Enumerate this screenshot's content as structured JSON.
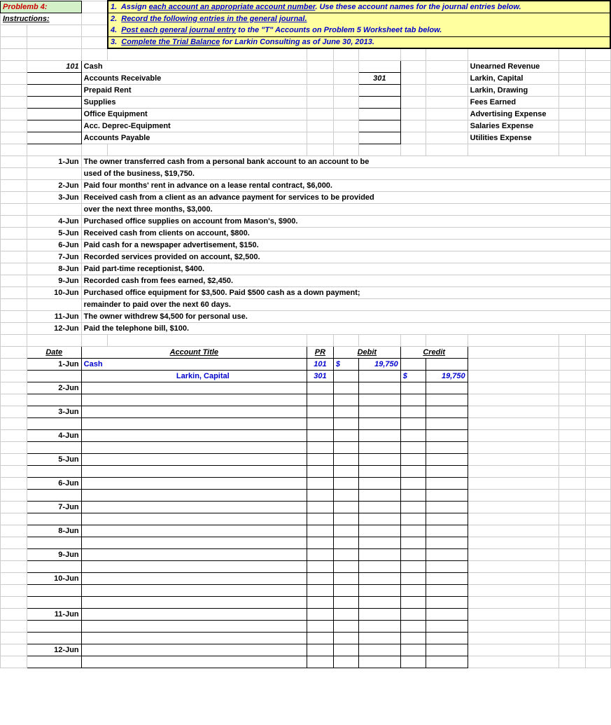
{
  "header": {
    "problem": "Problemb 4:",
    "instructions_label": "Instructions:",
    "lines": [
      {
        "num": "1.",
        "prefix": "Assign ",
        "link": "each account an appropriate account number",
        "suffix": ".  Use these account names for the journal entries below."
      },
      {
        "num": "2.",
        "prefix": "",
        "link": "Record the following entries in the general journal.",
        "suffix": ""
      },
      {
        "num": "4.",
        "prefix": "",
        "link": "Post each general journal entry",
        "suffix": " to the \"T\" Accounts on Problem 5 Worksheet tab below."
      },
      {
        "num": "3.",
        "prefix": "",
        "link": "Complete the Trial Balance",
        "suffix": " for Larkin Consulting as of June 30, 2013."
      }
    ]
  },
  "accounts_left": [
    {
      "num": "101",
      "name": "Cash"
    },
    {
      "num": "",
      "name": "Accounts Receivable"
    },
    {
      "num": "",
      "name": "Prepaid Rent"
    },
    {
      "num": "",
      "name": "Supplies"
    },
    {
      "num": "",
      "name": "Office Equipment"
    },
    {
      "num": "",
      "name": "Acc. Deprec-Equipment"
    },
    {
      "num": "",
      "name": "Accounts Payable"
    }
  ],
  "accounts_right": [
    {
      "num": "",
      "name": "Unearned Revenue"
    },
    {
      "num": "301",
      "name": "Larkin, Capital"
    },
    {
      "num": "",
      "name": "Larkin, Drawing"
    },
    {
      "num": "",
      "name": "Fees Earned"
    },
    {
      "num": "",
      "name": "Advertising Expense"
    },
    {
      "num": "",
      "name": "Salaries Expense"
    },
    {
      "num": "",
      "name": "Utilities Expense"
    }
  ],
  "transactions": [
    {
      "date": "1-Jun",
      "text": "The owner transferred cash from a personal bank account to an account to be"
    },
    {
      "date": "",
      "text": "used of the business, $19,750."
    },
    {
      "date": "2-Jun",
      "text": "Paid four months' rent in advance on a lease rental contract, $6,000."
    },
    {
      "date": "3-Jun",
      "text": "Received cash from a client as an advance payment for services to be provided"
    },
    {
      "date": "",
      "text": "over the next three months, $3,000."
    },
    {
      "date": "4-Jun",
      "text": "Purchased office supplies on account from Mason's, $900."
    },
    {
      "date": "5-Jun",
      "text": "Received cash from clients on account, $800."
    },
    {
      "date": "6-Jun",
      "text": "Paid cash for a newspaper advertisement, $150."
    },
    {
      "date": "7-Jun",
      "text": "Recorded services provided on account, $2,500."
    },
    {
      "date": "8-Jun",
      "text": "Paid part-time receptionist, $400."
    },
    {
      "date": "9-Jun",
      "text": "Recorded cash from fees earned, $2,450."
    },
    {
      "date": "10-Jun",
      "text": "Purchased office equipment for $3,500.  Paid $500 cash as a down payment;"
    },
    {
      "date": "",
      "text": "remainder to paid over the next 60 days."
    },
    {
      "date": "11-Jun",
      "text": "The owner withdrew $4,500 for personal use."
    },
    {
      "date": "12-Jun",
      "text": "Paid the telephone bill, $100."
    }
  ],
  "journal": {
    "headers": {
      "date": "Date",
      "title": "Account Title",
      "pr": "PR",
      "debit": "Debit",
      "credit": "Credit"
    },
    "rows": [
      {
        "date": "1-Jun",
        "title": "Cash",
        "indent": false,
        "pr": "101",
        "debit_s": "$",
        "debit_v": "19,750",
        "credit_s": "",
        "credit_v": "",
        "blue": true
      },
      {
        "date": "",
        "title": "Larkin, Capital",
        "indent": true,
        "pr": "301",
        "debit_s": "",
        "debit_v": "",
        "credit_s": "$",
        "credit_v": "19,750",
        "blue": true
      },
      {
        "date": "2-Jun",
        "title": "",
        "pr": "",
        "debit_s": "",
        "debit_v": "",
        "credit_s": "",
        "credit_v": ""
      },
      {
        "date": "",
        "title": "",
        "pr": "",
        "debit_s": "",
        "debit_v": "",
        "credit_s": "",
        "credit_v": ""
      },
      {
        "date": "3-Jun",
        "title": "",
        "pr": "",
        "debit_s": "",
        "debit_v": "",
        "credit_s": "",
        "credit_v": ""
      },
      {
        "date": "",
        "title": "",
        "pr": "",
        "debit_s": "",
        "debit_v": "",
        "credit_s": "",
        "credit_v": ""
      },
      {
        "date": "4-Jun",
        "title": "",
        "pr": "",
        "debit_s": "",
        "debit_v": "",
        "credit_s": "",
        "credit_v": ""
      },
      {
        "date": "",
        "title": "",
        "pr": "",
        "debit_s": "",
        "debit_v": "",
        "credit_s": "",
        "credit_v": ""
      },
      {
        "date": "5-Jun",
        "title": "",
        "pr": "",
        "debit_s": "",
        "debit_v": "",
        "credit_s": "",
        "credit_v": ""
      },
      {
        "date": "",
        "title": "",
        "pr": "",
        "debit_s": "",
        "debit_v": "",
        "credit_s": "",
        "credit_v": ""
      },
      {
        "date": "6-Jun",
        "title": "",
        "pr": "",
        "debit_s": "",
        "debit_v": "",
        "credit_s": "",
        "credit_v": ""
      },
      {
        "date": "",
        "title": "",
        "pr": "",
        "debit_s": "",
        "debit_v": "",
        "credit_s": "",
        "credit_v": ""
      },
      {
        "date": "7-Jun",
        "title": "",
        "pr": "",
        "debit_s": "",
        "debit_v": "",
        "credit_s": "",
        "credit_v": ""
      },
      {
        "date": "",
        "title": "",
        "pr": "",
        "debit_s": "",
        "debit_v": "",
        "credit_s": "",
        "credit_v": ""
      },
      {
        "date": "8-Jun",
        "title": "",
        "pr": "",
        "debit_s": "",
        "debit_v": "",
        "credit_s": "",
        "credit_v": ""
      },
      {
        "date": "",
        "title": "",
        "pr": "",
        "debit_s": "",
        "debit_v": "",
        "credit_s": "",
        "credit_v": ""
      },
      {
        "date": "9-Jun",
        "title": "",
        "pr": "",
        "debit_s": "",
        "debit_v": "",
        "credit_s": "",
        "credit_v": ""
      },
      {
        "date": "",
        "title": "",
        "pr": "",
        "debit_s": "",
        "debit_v": "",
        "credit_s": "",
        "credit_v": ""
      },
      {
        "date": "10-Jun",
        "title": "",
        "pr": "",
        "debit_s": "",
        "debit_v": "",
        "credit_s": "",
        "credit_v": ""
      },
      {
        "date": "",
        "title": "",
        "pr": "",
        "debit_s": "",
        "debit_v": "",
        "credit_s": "",
        "credit_v": ""
      },
      {
        "date": "",
        "title": "",
        "pr": "",
        "debit_s": "",
        "debit_v": "",
        "credit_s": "",
        "credit_v": ""
      },
      {
        "date": "11-Jun",
        "title": "",
        "pr": "",
        "debit_s": "",
        "debit_v": "",
        "credit_s": "",
        "credit_v": ""
      },
      {
        "date": "",
        "title": "",
        "pr": "",
        "debit_s": "",
        "debit_v": "",
        "credit_s": "",
        "credit_v": ""
      },
      {
        "date": "",
        "title": "",
        "pr": "",
        "debit_s": "",
        "debit_v": "",
        "credit_s": "",
        "credit_v": ""
      },
      {
        "date": "12-Jun",
        "title": "",
        "pr": "",
        "debit_s": "",
        "debit_v": "",
        "credit_s": "",
        "credit_v": ""
      },
      {
        "date": "",
        "title": "",
        "pr": "",
        "debit_s": "",
        "debit_v": "",
        "credit_s": "",
        "credit_v": ""
      }
    ]
  }
}
